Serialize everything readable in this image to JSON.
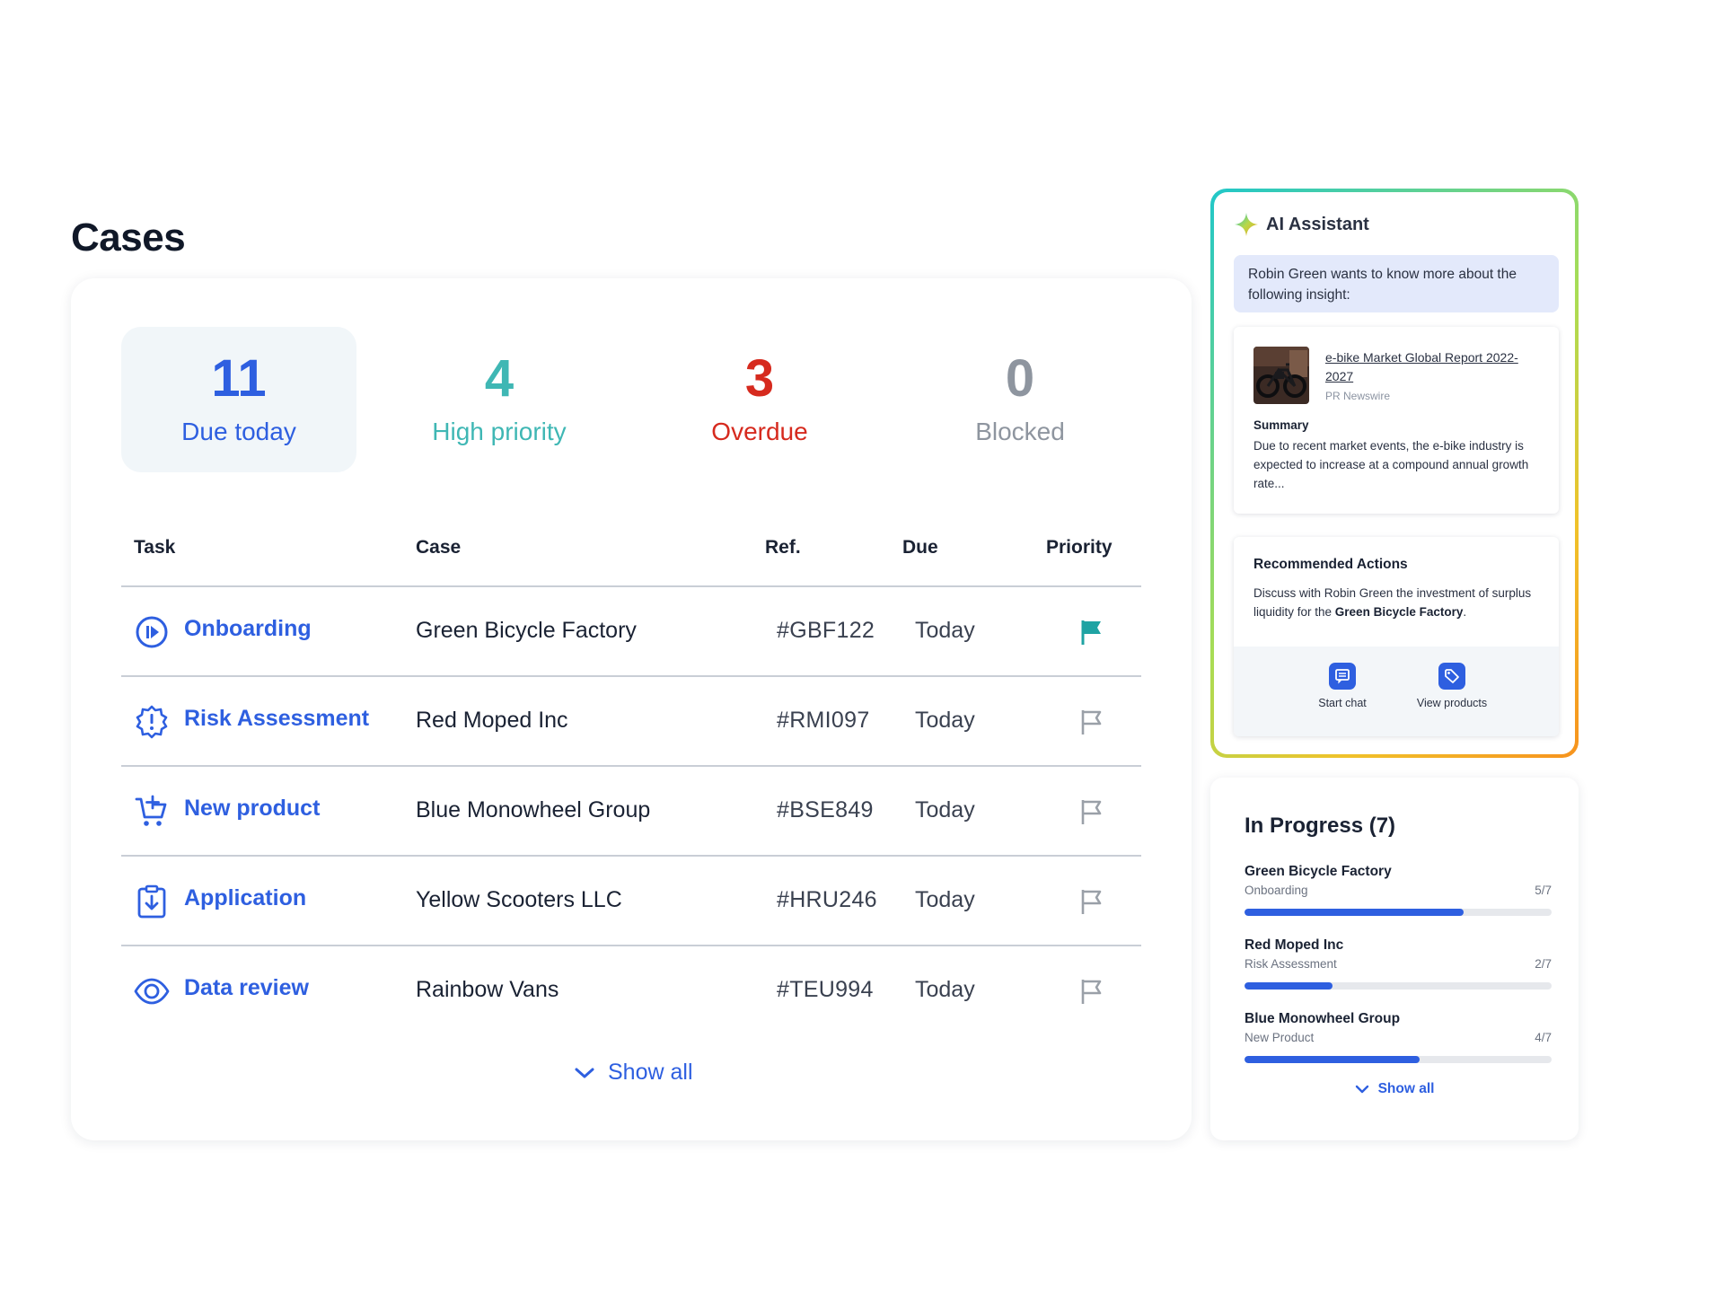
{
  "page": {
    "title": "Cases"
  },
  "stats": [
    {
      "value": "11",
      "label": "Due today",
      "color": "#2e5fe0",
      "active": true
    },
    {
      "value": "4",
      "label": "High priority",
      "color": "#3fb7b4",
      "active": false
    },
    {
      "value": "3",
      "label": "Overdue",
      "color": "#d62a1e",
      "active": false
    },
    {
      "value": "0",
      "label": "Blocked",
      "color": "#8e959f",
      "active": false
    }
  ],
  "table": {
    "headers": {
      "task": "Task",
      "case": "Case",
      "ref": "Ref.",
      "due": "Due",
      "priority": "Priority"
    },
    "rows": [
      {
        "task": "Onboarding",
        "icon": "play-circle-icon",
        "case": "Green Bicycle Factory",
        "ref": "#GBF122",
        "due": "Today",
        "priority_flag": "filled-flag-icon"
      },
      {
        "task": "Risk Assessment",
        "icon": "alert-badge-icon",
        "case": "Red Moped Inc",
        "ref": "#RMI097",
        "due": "Today",
        "priority_flag": "outline-flag-icon"
      },
      {
        "task": "New product",
        "icon": "cart-add-icon",
        "case": "Blue Monowheel Group",
        "ref": "#BSE849",
        "due": "Today",
        "priority_flag": "outline-flag-icon"
      },
      {
        "task": "Application",
        "icon": "clipboard-download-icon",
        "case": "Yellow Scooters LLC",
        "ref": "#HRU246",
        "due": "Today",
        "priority_flag": "outline-flag-icon"
      },
      {
        "task": "Data review",
        "icon": "eye-icon",
        "case": "Rainbow Vans",
        "ref": "#TEU994",
        "due": "Today",
        "priority_flag": "outline-flag-icon"
      }
    ],
    "show_all": "Show all"
  },
  "ai": {
    "title": "AI Assistant",
    "icon": "sparkle-icon",
    "insight": "Robin Green wants to know more about the following insight:",
    "report": {
      "title": "e-bike Market Global Report 2022-2027",
      "source": "PR Newswire",
      "summary_label": "Summary",
      "summary": "Due to recent market events, the e-bike industry is expected to increase at a compound annual growth rate..."
    },
    "recommended": {
      "title": "Recommended Actions",
      "text_before": "Discuss with Robin Green the investment of surplus liquidity for the ",
      "text_bold": "Green Bicycle Factory",
      "text_after": ".",
      "buttons": [
        {
          "label": "Start chat",
          "icon": "chat-icon"
        },
        {
          "label": "View products",
          "icon": "tag-icon"
        }
      ]
    }
  },
  "progress": {
    "title": "In Progress (7)",
    "items": [
      {
        "name": "Green Bicycle Factory",
        "stage": "Onboarding",
        "done": 5,
        "total": 7,
        "fraction": "5/7"
      },
      {
        "name": "Red Moped Inc",
        "stage": "Risk Assessment",
        "done": 2,
        "total": 7,
        "fraction": "2/7"
      },
      {
        "name": "Blue Monowheel Group",
        "stage": "New Product",
        "done": 4,
        "total": 7,
        "fraction": "4/7"
      }
    ],
    "show_all": "Show all"
  },
  "colors": {
    "accent": "#2e5fe0",
    "teal": "#3fb7b4",
    "red": "#d62a1e",
    "gray": "#8e959f"
  }
}
